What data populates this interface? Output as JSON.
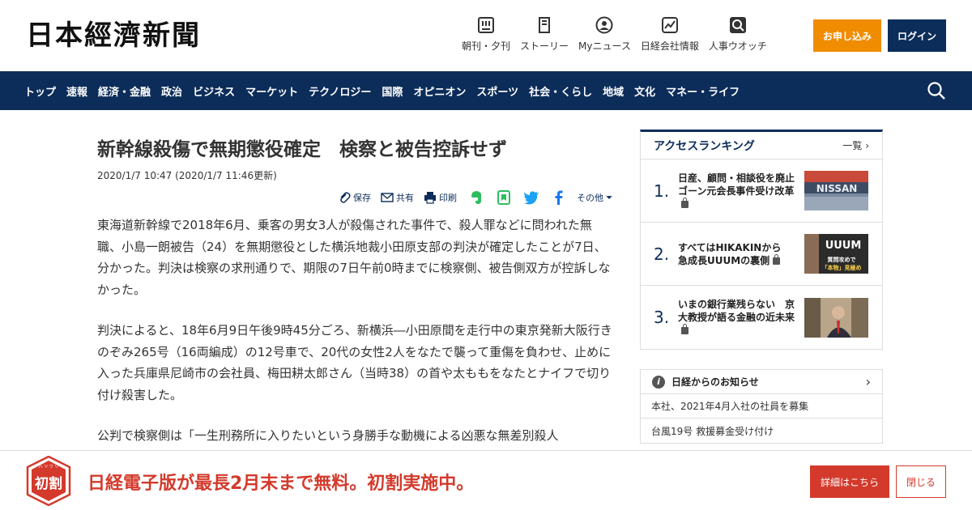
{
  "header": {
    "logo": "日本經濟新聞",
    "nav": [
      {
        "label": "朝刊・夕刊",
        "icon": "newspaper-icon"
      },
      {
        "label": "ストーリー",
        "icon": "book-icon"
      },
      {
        "label": "Myニュース",
        "icon": "person-icon"
      },
      {
        "label": "日経会社情報",
        "icon": "chart-icon"
      },
      {
        "label": "人事ウオッチ",
        "icon": "magnifier-icon"
      }
    ],
    "subscribe_label": "お申し込み",
    "login_label": "ログイン"
  },
  "navbar": {
    "items": [
      "トップ",
      "速報",
      "経済・金融",
      "政治",
      "ビジネス",
      "マーケット",
      "テクノロジー",
      "国際",
      "オピニオン",
      "スポーツ",
      "社会・くらし",
      "地域",
      "文化",
      "マネー・ライフ"
    ]
  },
  "article": {
    "title": "新幹線殺傷で無期懲役確定　検察と被告控訴せず",
    "date": "2020/1/7 10:47 (2020/1/7 11:46更新)",
    "share": {
      "save": "保存",
      "share": "共有",
      "print": "印刷",
      "more": "その他"
    },
    "paragraphs": [
      "東海道新幹線で2018年6月、乗客の男女3人が殺傷された事件で、殺人罪などに問われた無職、小島一朗被告（24）を無期懲役とした横浜地裁小田原支部の判決が確定したことが7日、分かった。判決は検察の求刑通りで、期限の7日午前0時までに検察側、被告側双方が控訴しなかった。",
      "判決によると、18年6月9日午後9時45分ごろ、新横浜―小田原間を走行中の東京発新大阪行きのぞみ265号（16両編成）の12号車で、20代の女性2人をなたで襲って重傷を負わせ、止めに入った兵庫県尼崎市の会社員、梅田耕太郎さん（当時38）の首や太ももをなたとナイフで切り付け殺害した。",
      "公判で検察側は「一生刑務所に入りたいという身勝手な動機による凶悪な無差別殺人"
    ]
  },
  "ranking": {
    "title": "アクセスランキング",
    "more": "一覧",
    "items": [
      {
        "rank": "1.",
        "text": "日産、顧問・相談役を廃止　ゴーン元会長事件受け改革"
      },
      {
        "rank": "2.",
        "text": "すべてはHIKAKINから　急成長UUUMの裏側"
      },
      {
        "rank": "3.",
        "text": "いまの銀行業残らない　京大教授が語る金融の近未来"
      }
    ],
    "thumb_texts": [
      "NISSAN",
      "UUUM",
      "質問攻めで",
      "「本物」見極め"
    ]
  },
  "notice": {
    "title": "日経からのお知らせ",
    "items": [
      "本社、2021年4月入社の社員を募集",
      "台風19号 救援募金受け付け"
    ]
  },
  "promo": {
    "badge_text": "初割",
    "badge_ruby": "ハ ツ ワ リ",
    "text": "日経電子版が最長2月末まで無料。初割実施中。",
    "detail_label": "詳細はこちら",
    "close_label": "閉じる"
  },
  "colors": {
    "navy": "#0c2d5a",
    "orange": "#f08c00",
    "red": "#d33a2c"
  }
}
